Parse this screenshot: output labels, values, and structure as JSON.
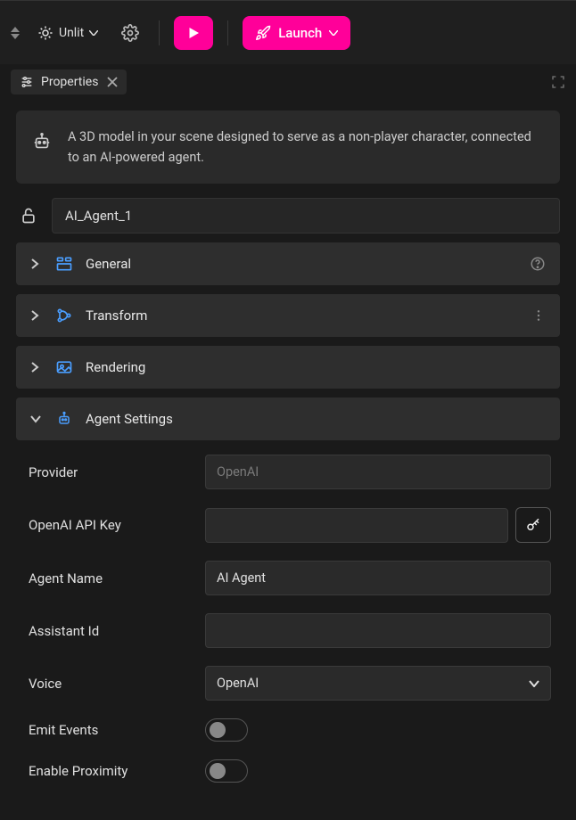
{
  "topbar": {
    "light_mode": "Unlit",
    "launch_label": "Launch"
  },
  "panel": {
    "title": "Properties"
  },
  "info": {
    "description": "A 3D model in your scene designed to serve as a non-player character, connected to an AI-powered agent."
  },
  "object": {
    "name": "AI_Agent_1"
  },
  "sections": {
    "general": {
      "title": "General"
    },
    "transform": {
      "title": "Transform"
    },
    "rendering": {
      "title": "Rendering"
    },
    "agent": {
      "title": "Agent Settings"
    }
  },
  "agent_settings": {
    "provider_label": "Provider",
    "provider_placeholder": "OpenAI",
    "provider_value": "",
    "api_key_label": "OpenAI API Key",
    "api_key_value": "",
    "agent_name_label": "Agent Name",
    "agent_name_value": "AI Agent",
    "assistant_id_label": "Assistant Id",
    "assistant_id_value": "",
    "voice_label": "Voice",
    "voice_value": "OpenAI",
    "emit_events_label": "Emit Events",
    "emit_events_value": false,
    "enable_proximity_label": "Enable Proximity",
    "enable_proximity_value": false
  }
}
